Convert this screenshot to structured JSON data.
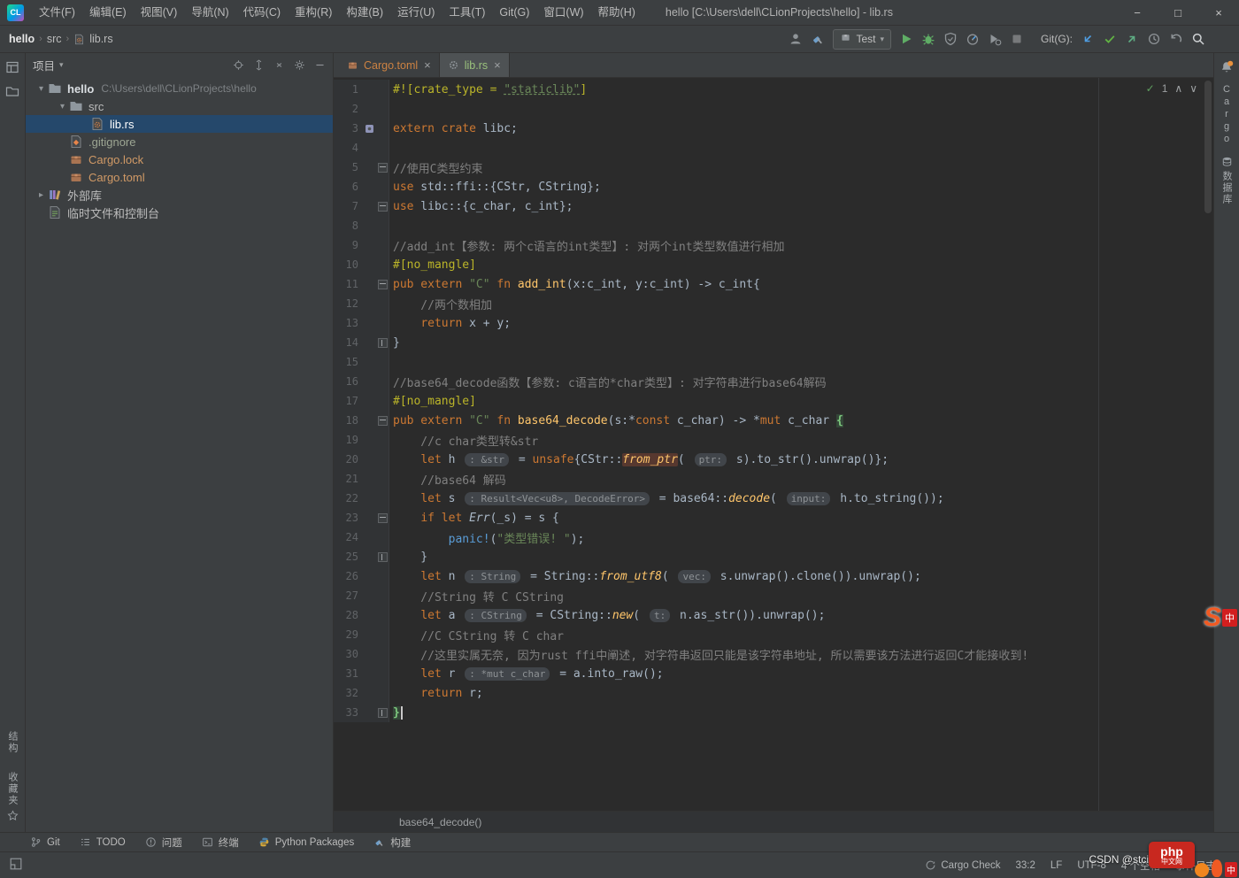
{
  "titlebar": {
    "logo": "CL",
    "menus": [
      "文件(F)",
      "编辑(E)",
      "视图(V)",
      "导航(N)",
      "代码(C)",
      "重构(R)",
      "构建(B)",
      "运行(U)",
      "工具(T)",
      "Git(G)",
      "窗口(W)",
      "帮助(H)"
    ],
    "title": "hello [C:\\Users\\dell\\CLionProjects\\hello] - lib.rs",
    "minimize": "−",
    "maximize": "□",
    "close": "×"
  },
  "toolbar": {
    "breadcrumbs": [
      "hello",
      "src",
      "lib.rs"
    ],
    "left_icons": [
      "user-icon",
      "build-hammer-icon"
    ],
    "run_config": {
      "icon": "cargo-test-icon",
      "label": "Test",
      "chevron": "▾"
    },
    "run_icons": [
      "run-icon",
      "debug-icon",
      "coverage-icon",
      "profiler-icon",
      "run-profiler-icon",
      "stop-icon"
    ],
    "git_label": "Git(G):",
    "git_icons": [
      "update-arrow-icon",
      "commit-check-icon",
      "push-arrow-icon",
      "history-clock-icon",
      "rollback-icon"
    ],
    "search": "search-icon"
  },
  "left_stripe": {
    "top_icons": [
      "project-view-icon",
      "folder-tool-icon"
    ],
    "bottom_items": [
      {
        "label": "结构",
        "icon": ""
      },
      {
        "label": "收藏夹",
        "icon": "star-icon"
      }
    ]
  },
  "right_stripe": {
    "bell": "bell-icon",
    "items": [
      {
        "icon": "",
        "label": "Cargo"
      },
      {
        "icon": "database-icon",
        "label": "数据库"
      }
    ]
  },
  "project_panel": {
    "title": "项目",
    "title_chevron": "▾",
    "header_icons": [
      "locate-target-icon",
      "expand-all-icon",
      "collapse-all-icon",
      "gear-icon",
      "hide-panel-icon"
    ],
    "tree": [
      {
        "depth": 0,
        "chevron": "▾",
        "icon": "folder-icon",
        "label": "hello",
        "bold": true,
        "sub": "C:\\Users\\dell\\CLionProjects\\hello"
      },
      {
        "depth": 1,
        "chevron": "▾",
        "icon": "folder-icon",
        "label": "src"
      },
      {
        "depth": 2,
        "chevron": "",
        "icon": "rust-file-icon",
        "label": "lib.rs",
        "selected": true
      },
      {
        "depth": 1,
        "chevron": "",
        "icon": "gitignore-icon",
        "label": ".gitignore",
        "color": "#9da693"
      },
      {
        "depth": 1,
        "chevron": "",
        "icon": "cargo-box-icon",
        "label": "Cargo.lock",
        "color": "#d19a66"
      },
      {
        "depth": 1,
        "chevron": "",
        "icon": "cargo-box-icon",
        "label": "Cargo.toml",
        "color": "#d19a66"
      },
      {
        "depth": 0,
        "chevron": "▸",
        "icon": "library-icon",
        "label": "外部库"
      },
      {
        "depth": 0,
        "chevron": "",
        "icon": "scratch-icon",
        "label": "临时文件和控制台"
      }
    ]
  },
  "tabs": [
    {
      "icon": "cargo-box-icon",
      "label": "Cargo.toml",
      "close": "×",
      "active": false,
      "color": "#cc8242"
    },
    {
      "icon": "rust-gear-icon",
      "label": "lib.rs",
      "close": "×",
      "active": true,
      "color": "#9ac27c"
    }
  ],
  "editor": {
    "inspection": {
      "check": "✓",
      "count": "1",
      "up": "∧",
      "down": "∨"
    },
    "breadcrumb": "base64_decode()",
    "lines": [
      {
        "n": 1,
        "s": [
          [
            "attr",
            "#![crate_type = "
          ],
          [
            "strul",
            "\"staticlib\""
          ],
          [
            "attr",
            "]"
          ]
        ]
      },
      {
        "n": 2,
        "s": []
      },
      {
        "n": 3,
        "gicon": "crate-gutter-icon",
        "s": [
          [
            "kw",
            "extern crate"
          ],
          [
            "plain",
            " libc;"
          ]
        ]
      },
      {
        "n": 4,
        "s": []
      },
      {
        "n": 5,
        "fold": "open",
        "s": [
          [
            "cmt",
            "//使用C类型约束"
          ]
        ]
      },
      {
        "n": 6,
        "s": [
          [
            "kw",
            "use"
          ],
          [
            "plain",
            " std::ffi::{CStr, CString};"
          ]
        ]
      },
      {
        "n": 7,
        "fold": "open",
        "s": [
          [
            "kw",
            "use"
          ],
          [
            "plain",
            " libc::{c_char, c_int};"
          ]
        ]
      },
      {
        "n": 8,
        "s": []
      },
      {
        "n": 9,
        "s": [
          [
            "cmt",
            "//add_int【参数: 两个c语言的int类型】: 对两个int类型数值进行相加"
          ]
        ]
      },
      {
        "n": 10,
        "s": [
          [
            "attr",
            "#[no_mangle]"
          ]
        ]
      },
      {
        "n": 11,
        "fold": "open",
        "s": [
          [
            "kw",
            "pub extern "
          ],
          [
            "str",
            "\"C\""
          ],
          [
            "kw",
            " fn "
          ],
          [
            "fn",
            "add_int"
          ],
          [
            "plain",
            "(x:c_int, y:c_int) -> c_int{"
          ]
        ]
      },
      {
        "n": 12,
        "s": [
          [
            "cmt",
            "    //两个数相加"
          ]
        ]
      },
      {
        "n": 13,
        "s": [
          [
            "plain",
            "    "
          ],
          [
            "kw",
            "return"
          ],
          [
            "plain",
            " x + y;"
          ]
        ]
      },
      {
        "n": 14,
        "fold": "close",
        "s": [
          [
            "plain",
            "}"
          ]
        ]
      },
      {
        "n": 15,
        "s": []
      },
      {
        "n": 16,
        "s": [
          [
            "cmt",
            "//base64_decode函数【参数: c语言的*char类型】: 对字符串进行base64解码"
          ]
        ]
      },
      {
        "n": 17,
        "s": [
          [
            "attr",
            "#[no_mangle]"
          ]
        ]
      },
      {
        "n": 18,
        "fold": "open",
        "s": [
          [
            "kw",
            "pub extern "
          ],
          [
            "str",
            "\"C\""
          ],
          [
            "kw",
            " fn "
          ],
          [
            "fn",
            "base64_decode"
          ],
          [
            "plain",
            "(s:*"
          ],
          [
            "kw",
            "const"
          ],
          [
            "plain",
            " c_char) -> *"
          ],
          [
            "kw",
            "mut"
          ],
          [
            "plain",
            " c_char "
          ],
          [
            "brace",
            "{"
          ]
        ]
      },
      {
        "n": 19,
        "s": [
          [
            "cmt",
            "    //c char类型转&str"
          ]
        ]
      },
      {
        "n": 20,
        "s": [
          [
            "plain",
            "    "
          ],
          [
            "kw",
            "let"
          ],
          [
            "plain",
            " h "
          ],
          [
            "hint",
            ": &str"
          ],
          [
            "plain",
            " = "
          ],
          [
            "kw",
            "unsafe"
          ],
          [
            "plain",
            "{CStr::"
          ],
          [
            "unsafe",
            "from_ptr"
          ],
          [
            "plain",
            "( "
          ],
          [
            "hint",
            "ptr:"
          ],
          [
            "plain",
            " s).to_str().unwrap()};"
          ]
        ]
      },
      {
        "n": 21,
        "s": [
          [
            "cmt",
            "    //base64 解码"
          ]
        ]
      },
      {
        "n": 22,
        "s": [
          [
            "plain",
            "    "
          ],
          [
            "kw",
            "let"
          ],
          [
            "plain",
            " s "
          ],
          [
            "hint",
            ": Result<Vec<u8>, DecodeError>"
          ],
          [
            "plain",
            " = base64::"
          ],
          [
            "fni",
            "decode"
          ],
          [
            "plain",
            "( "
          ],
          [
            "hint",
            "input:"
          ],
          [
            "plain",
            " h.to_string());"
          ]
        ]
      },
      {
        "n": 23,
        "fold": "open",
        "s": [
          [
            "plain",
            "    "
          ],
          [
            "kw",
            "if let "
          ],
          [
            "variant",
            "Err"
          ],
          [
            "plain",
            "(_s) = s {"
          ]
        ]
      },
      {
        "n": 24,
        "s": [
          [
            "plain",
            "        "
          ],
          [
            "macro",
            "panic!"
          ],
          [
            "plain",
            "("
          ],
          [
            "str",
            "\"类型错误! \""
          ],
          [
            "plain",
            ");"
          ]
        ]
      },
      {
        "n": 25,
        "fold": "close",
        "s": [
          [
            "plain",
            "    }"
          ]
        ]
      },
      {
        "n": 26,
        "s": [
          [
            "plain",
            "    "
          ],
          [
            "kw",
            "let"
          ],
          [
            "plain",
            " n "
          ],
          [
            "hint",
            ": String"
          ],
          [
            "plain",
            " = String::"
          ],
          [
            "fni",
            "from_utf8"
          ],
          [
            "plain",
            "( "
          ],
          [
            "hint",
            "vec:"
          ],
          [
            "plain",
            " s.unwrap().clone()).unwrap();"
          ]
        ]
      },
      {
        "n": 27,
        "s": [
          [
            "cmt",
            "    //String 转 C CString"
          ]
        ]
      },
      {
        "n": 28,
        "s": [
          [
            "plain",
            "    "
          ],
          [
            "kw",
            "let"
          ],
          [
            "plain",
            " a "
          ],
          [
            "hint",
            ": CString"
          ],
          [
            "plain",
            " = CString::"
          ],
          [
            "fni",
            "new"
          ],
          [
            "plain",
            "( "
          ],
          [
            "hint",
            "t:"
          ],
          [
            "plain",
            " n.as_str()).unwrap();"
          ]
        ]
      },
      {
        "n": 29,
        "s": [
          [
            "cmt",
            "    //C CString 转 C char"
          ]
        ]
      },
      {
        "n": 30,
        "s": [
          [
            "cmt",
            "    //这里实属无奈, 因为rust ffi中阐述, 对字符串返回只能是该字符串地址, 所以需要该方法进行返回C才能接收到!"
          ]
        ]
      },
      {
        "n": 31,
        "s": [
          [
            "plain",
            "    "
          ],
          [
            "kw",
            "let"
          ],
          [
            "plain",
            " r "
          ],
          [
            "hint",
            ": *mut c_char"
          ],
          [
            "plain",
            " = a.into_raw();"
          ]
        ]
      },
      {
        "n": 32,
        "s": [
          [
            "plain",
            "    "
          ],
          [
            "kw",
            "return"
          ],
          [
            "plain",
            " r;"
          ]
        ]
      },
      {
        "n": 33,
        "fold": "close",
        "caret": true,
        "s": [
          [
            "brace",
            "}"
          ]
        ]
      }
    ]
  },
  "bottom_bar": [
    {
      "icon": "git-branch-icon",
      "label": "Git"
    },
    {
      "icon": "todo-icon",
      "label": "TODO"
    },
    {
      "icon": "problems-icon",
      "label": "问题"
    },
    {
      "icon": "terminal-icon",
      "label": "终端"
    },
    {
      "icon": "python-icon",
      "label": "Python Packages"
    },
    {
      "icon": "build-hammer-icon",
      "label": "构建"
    }
  ],
  "status_bar": {
    "left_icon": "tool-windows-icon",
    "items": [
      {
        "icon": "cargo-check-icon",
        "label": "Cargo Check"
      },
      {
        "icon": "",
        "label": "33:2"
      },
      {
        "icon": "",
        "label": "LF"
      },
      {
        "icon": "",
        "label": "UTF-8"
      },
      {
        "icon": "",
        "label": "4 个空格"
      }
    ],
    "event_log": "事件日志"
  },
  "watermarks": {
    "csdn": "CSDN @stci两超",
    "php": "php",
    "php_sub": "中文网",
    "badge_s": "S",
    "badge_zh": "中",
    "corner_zh": "中"
  }
}
